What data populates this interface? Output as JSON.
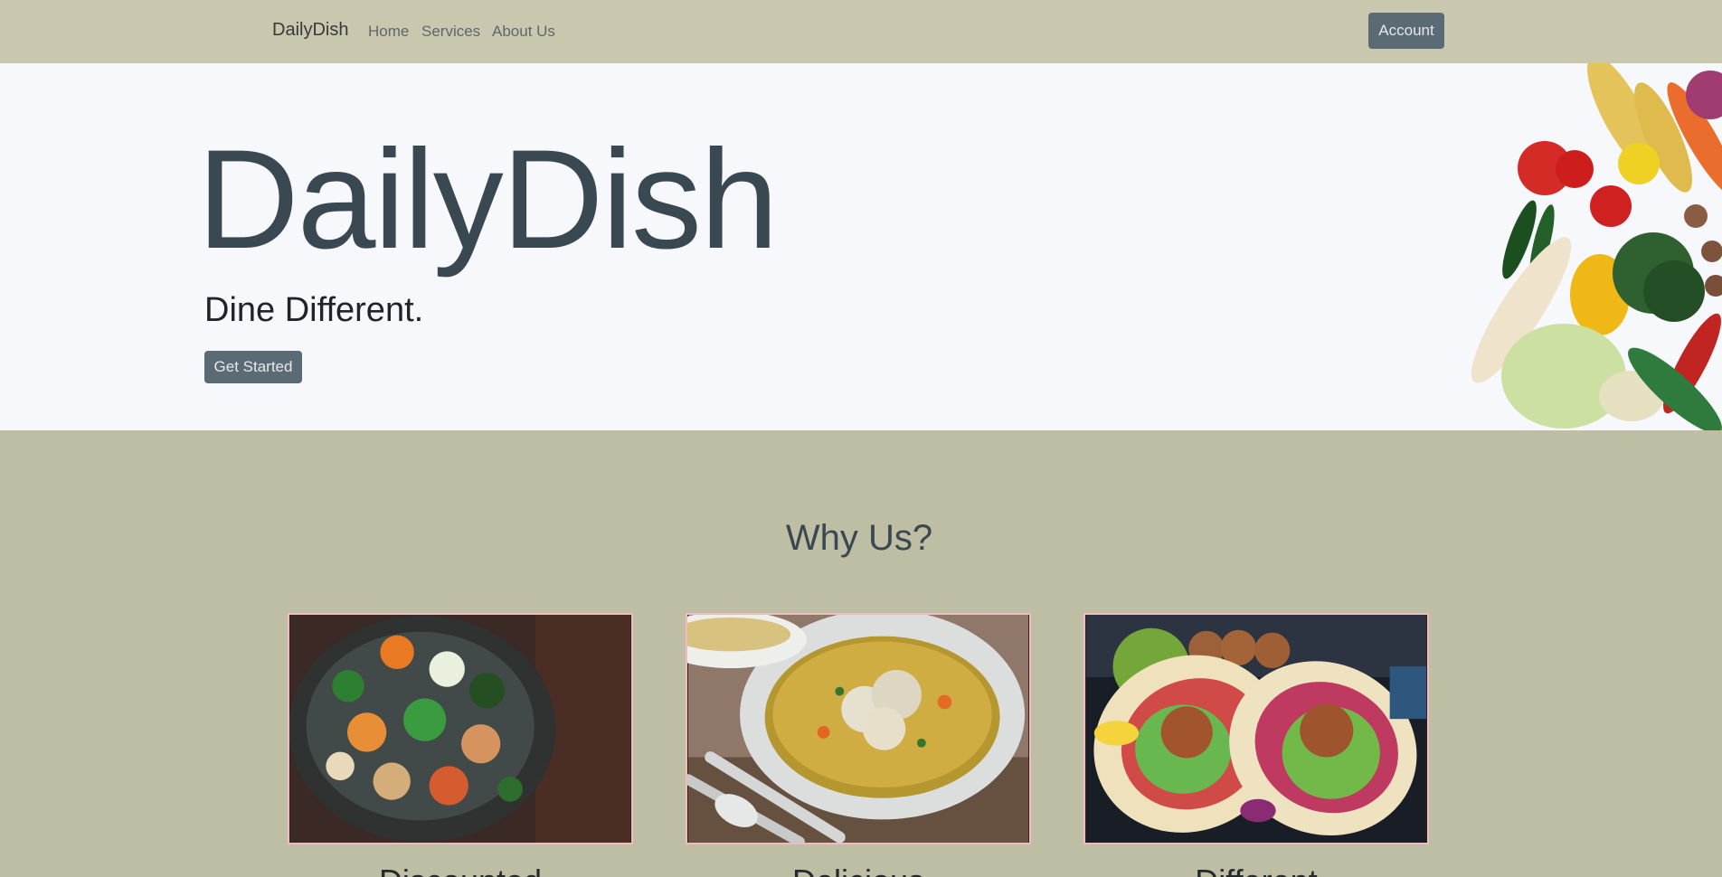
{
  "navbar": {
    "brand": "DailyDish",
    "links": {
      "home": "Home",
      "services": "Services",
      "about": "About Us"
    },
    "account_label": "Account"
  },
  "hero": {
    "title": "DailyDish",
    "subtitle": "Dine Different.",
    "button_label": "Get Started"
  },
  "why": {
    "title": "Why Us?",
    "cards": [
      {
        "image": "vegetable-chicken-stir-fry-image",
        "caption": "Discounted"
      },
      {
        "image": "chicken-soup-bowl-image",
        "caption": "Delicious"
      },
      {
        "image": "falafel-wrap-image",
        "caption": "Different"
      }
    ]
  },
  "colors": {
    "navbar_background": "#c9c8af",
    "page_background": "#bdbea3",
    "hero_background": "#f7f8fc",
    "button_background": "#5b6b75",
    "card_border": "#f2b9bf",
    "heading_text": "#3a4852"
  }
}
